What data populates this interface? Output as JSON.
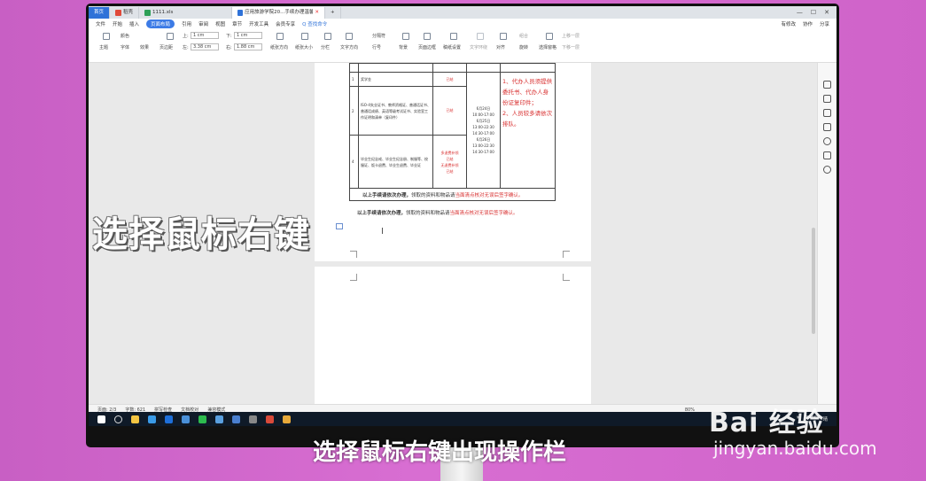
{
  "tabs": [
    {
      "label": "首页",
      "kind": "home"
    },
    {
      "label": "稻壳",
      "kind": "docer"
    },
    {
      "label": "1111.xls",
      "kind": "xls"
    },
    {
      "label": "应用旅游学院20...手续办理温馨提示",
      "kind": "doc"
    }
  ],
  "menu": {
    "file": "文件",
    "items": [
      "开始",
      "插入",
      "页面布局",
      "引用",
      "审阅",
      "视图",
      "章节",
      "开发工具",
      "会员专享"
    ],
    "active": "页面布局",
    "search": "Q 查找命令",
    "right": [
      "有修改",
      "协作",
      "分享"
    ]
  },
  "ribbon": {
    "theme": "主题",
    "colors": "颜色",
    "font": "字体",
    "effects": "效果",
    "margin": "页边距",
    "top": "上:",
    "top_val": "1 cm",
    "bottom": "下:",
    "bottom_val": "1 cm",
    "left": "左:",
    "left_val": "3.38 cm",
    "right": "右:",
    "right_val": "1.88 cm",
    "orientation": "纸张方向",
    "size": "纸张大小",
    "columns": "分栏",
    "textdir": "文字方向",
    "linenum": "行号",
    "sectbreak": "分隔符",
    "background": "背景",
    "border": "页面边框",
    "draft": "稿纸设置",
    "wrap": "文字环绕",
    "align": "对齐",
    "rotate": "旋转",
    "select": "选择窗格",
    "group": "组合",
    "up": "上移一层",
    "down": "下移一层"
  },
  "table": {
    "rows": [
      {
        "n": "1",
        "item": "奖学金",
        "fee": "已结",
        "time": "",
        "note": ""
      },
      {
        "n": "2",
        "item": "ISO-4失业证书、教师资格证、普通话证书、普通话成绩、英语等级考试证书、实验室工作证明和清单（复印件）",
        "fee": "已结",
        "time": "6月24日\n10:00-17:00\n6月25日\n13:00-22:30\n14:30-17:00\n6月26日\n13:00-22:30\n14:30-17:00",
        "note": "1、代办人员须提供委托书、代办人身份证复印件；\n2、人员较多请依次排队。"
      },
      {
        "n": "4",
        "item": "毕业生纪念戒、毕业生纪念册、制服等、校服证、饭卡退费、毕业生退费、毕业证",
        "fee": "多退费补领\n已结\n无退费补领\n已结",
        "time": "",
        "note": ""
      }
    ]
  },
  "notes": {
    "line1_bold": "以上手续请依次办理，",
    "line1_rest": "领取的资料和物品请",
    "line1_red": "当面清点核对无误后签字确认。",
    "line2_bold": "以上手续请依次办理，",
    "line2_rest": "领取的资料和物品请",
    "line2_red": "当面清点核对无误后签字确认。"
  },
  "status": {
    "page": "页面: 2/3",
    "words": "字数: 621",
    "spell": "拼写检查",
    "proof": "文档校对",
    "compat": "兼容模式",
    "zoom": "80%"
  },
  "taskbar": {
    "temp": "34°C",
    "weather": "晴"
  },
  "overlay": {
    "big": "选择鼠标右键",
    "subtitle": "选择鼠标右键出现操作栏"
  },
  "watermark": {
    "brand": "Bai 经验",
    "url": "jingyan.baidu.com"
  },
  "colors": {
    "accent": "#2f72d8",
    "red_text": "#d82e2e",
    "bg": "#d06ccb"
  }
}
